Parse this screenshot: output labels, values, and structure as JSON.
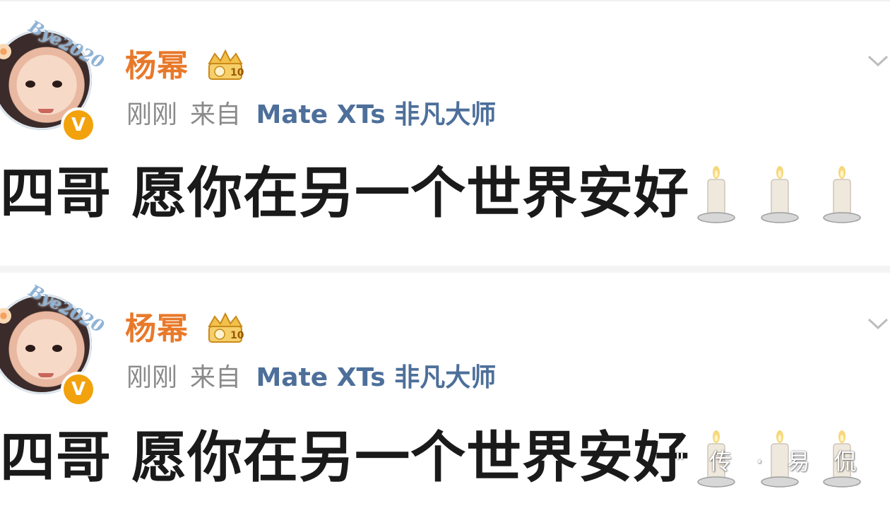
{
  "posts": [
    {
      "username": "杨幂",
      "avatar_text": "Bye2020",
      "verified_badge": "V",
      "timestamp": "刚刚",
      "source_prefix": "来自",
      "device": "Mate XTs 非凡大师",
      "content": "四哥 愿你在另一个世界安好",
      "emoji": [
        "candle",
        "candle",
        "candle"
      ]
    },
    {
      "username": "杨幂",
      "avatar_text": "Bye2020",
      "verified_badge": "V",
      "timestamp": "刚刚",
      "source_prefix": "来自",
      "device": "Mate XTs 非凡大师",
      "content": "四哥 愿你在另一个世界安好",
      "emoji": [
        "candle",
        "candle",
        "candle"
      ]
    }
  ],
  "watermark": "\" 传 ·  易  侃",
  "colors": {
    "username": "#e8792a",
    "meta": "#8a8a8a",
    "device": "#4d6f9a",
    "content": "#1a1a1a",
    "verified": "#f2a20c"
  },
  "icons": {
    "crown_badge": "crown-badge-icon",
    "dropdown": "chevron-down-icon",
    "candle": "candle-icon"
  }
}
